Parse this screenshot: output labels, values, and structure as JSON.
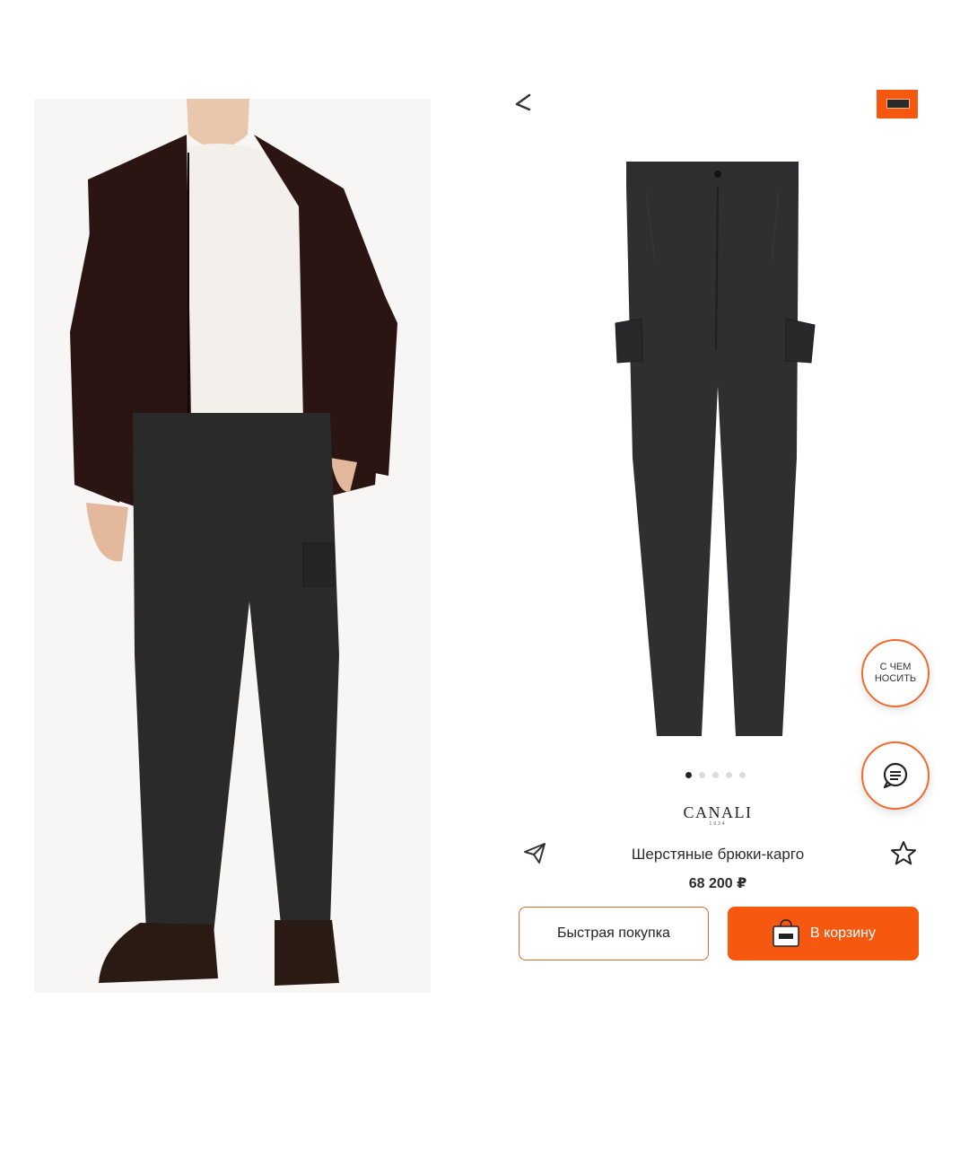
{
  "product": {
    "brand": "CANALI",
    "brand_sub": "1934",
    "title": "Шерстяные брюки-карго",
    "price": "68 200 ₽"
  },
  "gallery": {
    "total_images": 5,
    "active_index": 0
  },
  "actions": {
    "quick_buy_label": "Быстрая покупка",
    "add_to_cart_label": "В корзину",
    "what_to_wear_label_line1": "С ЧЕМ",
    "what_to_wear_label_line2": "НОСИТЬ"
  },
  "icons": {
    "back": "back-arrow-icon",
    "bag": "shopping-bag-icon",
    "share": "share-paper-plane-icon",
    "favorite": "star-outline-icon",
    "chat": "chat-bubble-icon"
  },
  "colors": {
    "accent": "#f5580e",
    "accent_border": "#e06a2c",
    "text": "#222222",
    "dot_inactive": "#dcdcdc"
  }
}
